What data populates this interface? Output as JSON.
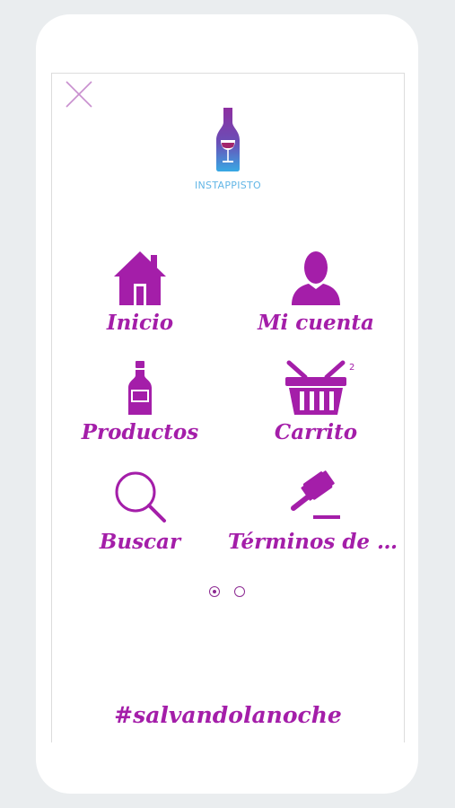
{
  "app": {
    "logo_text": "INSTAPPISTO",
    "colors": {
      "accent": "#a41ea9",
      "logo_text": "#62b6e6",
      "background": "#eaedef"
    }
  },
  "menu": {
    "items": [
      {
        "label": "Inicio",
        "icon": "home-icon"
      },
      {
        "label": "Mi cuenta",
        "icon": "user-icon"
      },
      {
        "label": "Productos",
        "icon": "bottle-icon"
      },
      {
        "label": "Carrito",
        "icon": "basket-icon",
        "badge": "2"
      },
      {
        "label": "Buscar",
        "icon": "search-icon"
      },
      {
        "label": "Términos de s...",
        "icon": "gavel-icon"
      }
    ]
  },
  "pager": {
    "pages": 2,
    "current": 1
  },
  "footer": {
    "hashtag": "#salvandolanoche"
  }
}
